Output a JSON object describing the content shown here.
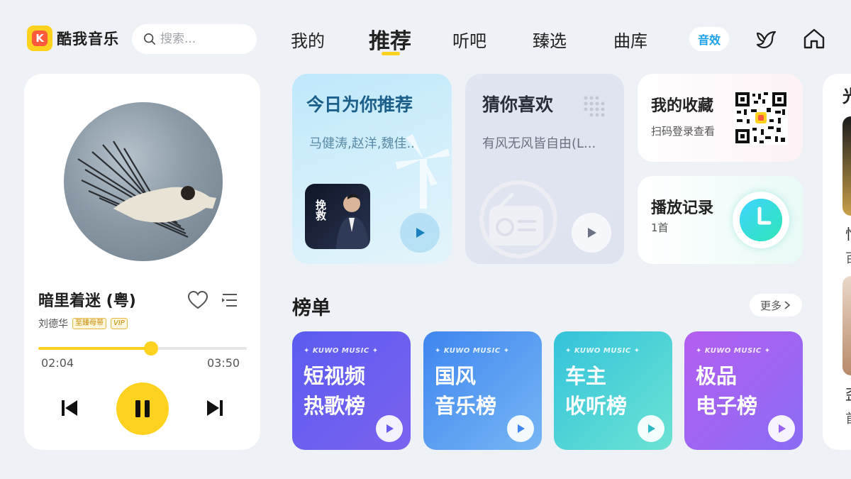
{
  "app": {
    "name": "酷我音乐",
    "logo_glyph": "K"
  },
  "search": {
    "placeholder": "搜索..."
  },
  "nav": {
    "tabs": [
      {
        "label": "我的"
      },
      {
        "label": "推荐",
        "active": true
      },
      {
        "label": "听吧"
      },
      {
        "label": "臻选"
      },
      {
        "label": "曲库"
      }
    ],
    "effect_label": "音效",
    "icons": [
      "bird-icon",
      "home-icon"
    ]
  },
  "player": {
    "song_title": "暗里着迷 (粤)",
    "artist": "刘德华",
    "badges": [
      "至臻母带",
      "VIP"
    ],
    "current_time": "02:04",
    "total_time": "03:50",
    "progress": 0.54
  },
  "cards": {
    "daily": {
      "title": "今日为你推荐",
      "subtitle": "马健涛,赵洋,魏佳..",
      "album_text": "挽救"
    },
    "guess": {
      "title": "猜你喜欢",
      "subtitle": "有风无风皆自由(L..."
    },
    "favorites": {
      "title": "我的收藏",
      "subtitle": "扫码登录查看"
    },
    "history": {
      "title": "播放记录",
      "subtitle": "1首"
    }
  },
  "charts": {
    "title": "榜单",
    "more_label": "更多",
    "brand": "✦ KUWO MUSIC ✦",
    "items": [
      {
        "line1": "短视频",
        "line2": "热歌榜",
        "color_a": "#5b5cf0",
        "color_b": "#8a63ee"
      },
      {
        "line1": "国风",
        "line2": "音乐榜",
        "color_a": "#4a8ef2",
        "color_b": "#7ab8f5"
      },
      {
        "line1": "车主",
        "line2": "收听榜",
        "color_a": "#38c6d8",
        "color_b": "#6fe0d6"
      },
      {
        "line1": "极品",
        "line2": "电子榜",
        "color_a": "#b45ef0",
        "color_b": "#8a6cf4"
      }
    ]
  },
  "side": {
    "partial_1": "光",
    "partial_2": "怕",
    "partial_3": "百",
    "partial_4": "歪",
    "partial_5": "首"
  },
  "colors": {
    "accent": "#ffd21f",
    "background": "#eef1f5",
    "effect": "#1aa0e8"
  }
}
